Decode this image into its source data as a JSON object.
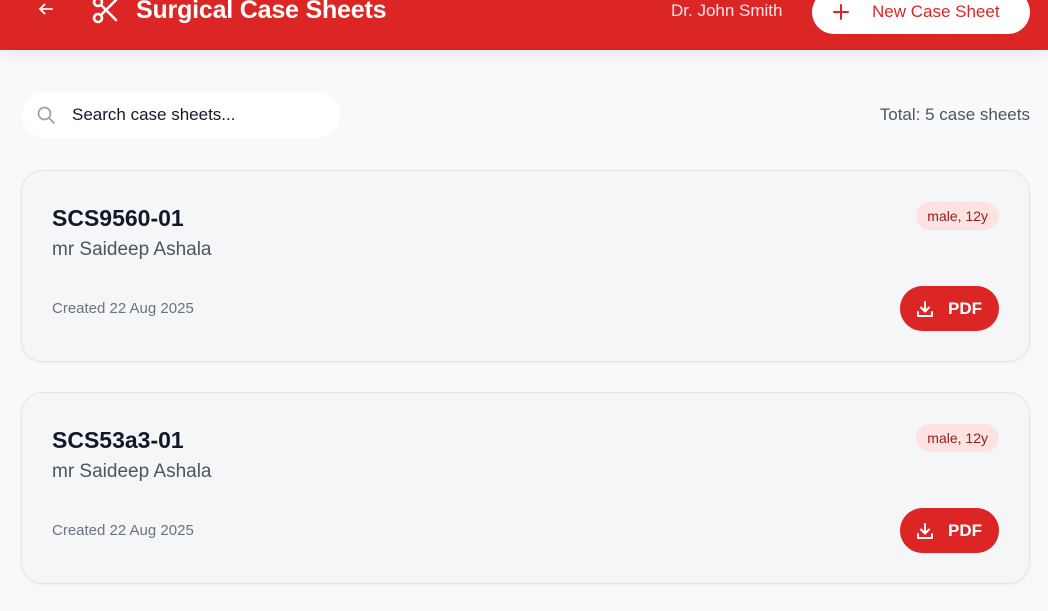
{
  "header": {
    "title": "Surgical Case Sheets",
    "user_name": "Dr. John Smith",
    "new_button_label": "New Case Sheet",
    "back_icon": "arrow-left-icon",
    "logo_icon": "scissors-icon",
    "accent_color": "#dc2626"
  },
  "search": {
    "placeholder": "Search case sheets...",
    "value": ""
  },
  "summary": {
    "total_text": "Total: 5 case sheets"
  },
  "cards": [
    {
      "case_id": "SCS9560-01",
      "patient": "mr Saideep Ashala",
      "badge": "male, 12y",
      "created": "Created 22 Aug 2025",
      "pdf_label": "PDF"
    },
    {
      "case_id": "SCS53a3-01",
      "patient": "mr Saideep Ashala",
      "badge": "male, 12y",
      "created": "Created 22 Aug 2025",
      "pdf_label": "PDF"
    }
  ]
}
